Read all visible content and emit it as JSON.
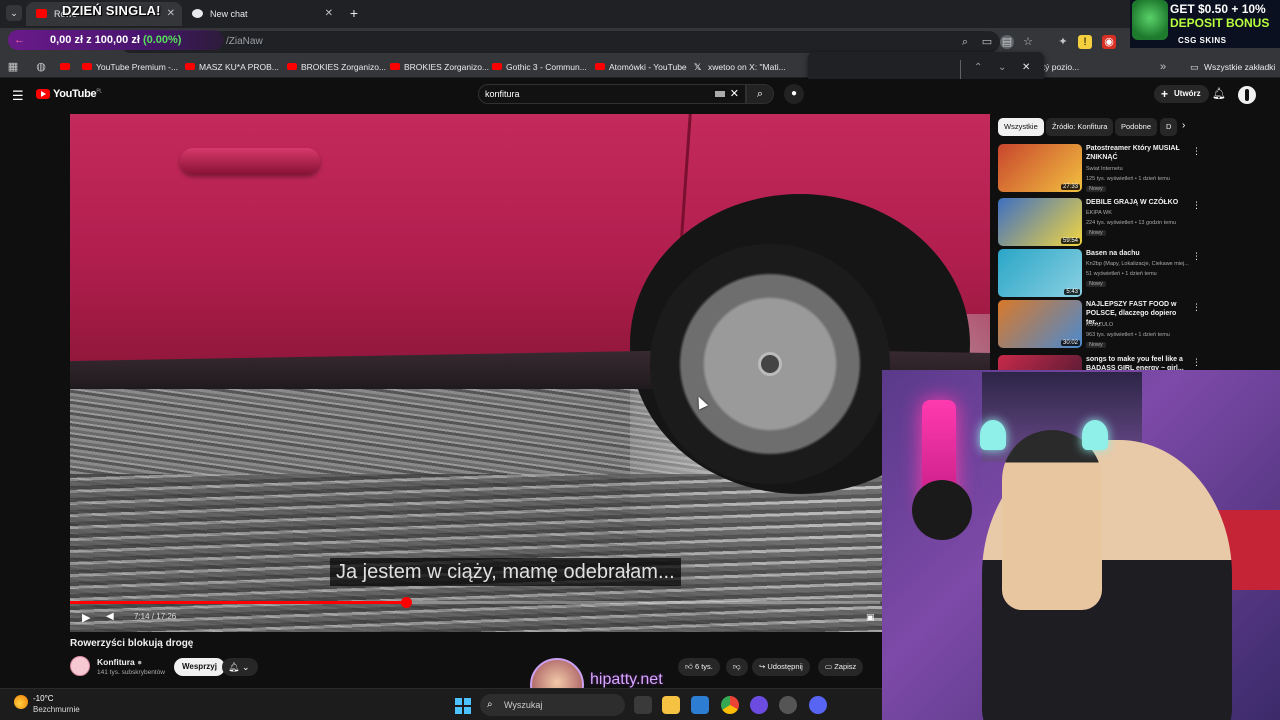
{
  "browser": {
    "tabs": [
      {
        "label": "Rowerzyści blokują drogę - YouTube",
        "visible_label": "Rowe",
        "active": true
      },
      {
        "label": "New chat",
        "active": false
      }
    ],
    "new_tab_symbol": "+",
    "url_fragment": "/ZiaNaw",
    "bookmarks": [
      {
        "label": "",
        "icon": "youtube-icon"
      },
      {
        "label": "YouTube Premium -...",
        "icon": "youtube-icon"
      },
      {
        "label": "MASZ KU*A PROB...",
        "icon": "youtube-icon"
      },
      {
        "label": "BROKIES Zorganizo...",
        "icon": "youtube-icon"
      },
      {
        "label": "BROKIES Zorganizo...",
        "icon": "youtube-icon"
      },
      {
        "label": "Gothic 3 - Commun...",
        "icon": "youtube-icon"
      },
      {
        "label": "Atomówki - YouTube",
        "icon": "youtube-icon"
      },
      {
        "label": "xwetoo on X: \"Mati...",
        "icon": "x-icon"
      },
      {
        "label": "owitý pozio...",
        "icon": "none"
      }
    ],
    "all_bookmarks_label": "Wszystkie zakładki"
  },
  "overlays": {
    "singla_banner": "DZIEŃ SINGLA!",
    "progress_amount": "0,00 zł z 100,00 zł",
    "progress_percent": "(0.00%)",
    "promo_line1": "GET $0.50 + 10%",
    "promo_line2": "DEPOSIT BONUS",
    "promo_brand": "CSG SKINS",
    "watermark": "hipatty.net"
  },
  "youtube": {
    "logo": "YouTube",
    "logo_region": "PL",
    "search_value": "konfitura",
    "create_label": "Utwórz",
    "player": {
      "caption": "Ja jestem w ciąży, mamę odebrałam...",
      "time": "7:14 / 17:26",
      "progress": 0.4149
    },
    "video_title": "Rowerzyści blokują drogę",
    "channel_name": "Konfitura",
    "channel_subs": "141 tys. subskrybentów",
    "support_label": "Wesprzyj",
    "like_count": "6 tys.",
    "share_label": "Udostępnij",
    "save_label": "Zapisz",
    "chips": [
      "Wszystkie",
      "Źródło: Konfitura",
      "Podobne",
      "D"
    ],
    "recommendations": [
      {
        "title": "Patostreamer Który MUSIAŁ ZNIKNĄĆ",
        "channel": "Świat Internetu",
        "stats": "125 tys. wyświetleń • 1 dzień temu",
        "badge": "Nowy",
        "duration": "27:33",
        "color1": "#c8462d",
        "color2": "#f2c040"
      },
      {
        "title": "DEBILE GRAJĄ W CZÓŁKO",
        "channel": "EKIPA WK",
        "stats": "224 tys. wyświetleń • 13 godzin temu",
        "badge": "Nowy",
        "duration": "59:54",
        "color1": "#3d6fc2",
        "color2": "#f2d640"
      },
      {
        "title": "Basen na dachu",
        "channel": "Kn2bp (Mapy, Lokalizacje, Ciekawe miej...",
        "stats": "51 wyświetleń • 1 dzień temu",
        "badge": "Nowy",
        "duration": "5:43",
        "color1": "#2aa6c8",
        "color2": "#8ad0e0"
      },
      {
        "title": "NAJLEPSZY FAST FOOD w POLSCE, dlaczego dopiero ter...",
        "channel": "KSIĄŻULO",
        "stats": "963 tys. wyświetleń • 1 dzień temu",
        "badge": "Nowy",
        "duration": "30:02",
        "color1": "#d9792a",
        "color2": "#4a8ad0"
      },
      {
        "title": "songs to make you feel like a BADASS GIRL energy ~ girl...",
        "channel": "",
        "stats": "",
        "badge": "",
        "duration": "",
        "color1": "#c82a4a",
        "color2": "#401830"
      }
    ]
  },
  "taskbar": {
    "temperature": "-10°C",
    "weather": "Bezchmurnie",
    "search_placeholder": "Wyszukaj"
  }
}
